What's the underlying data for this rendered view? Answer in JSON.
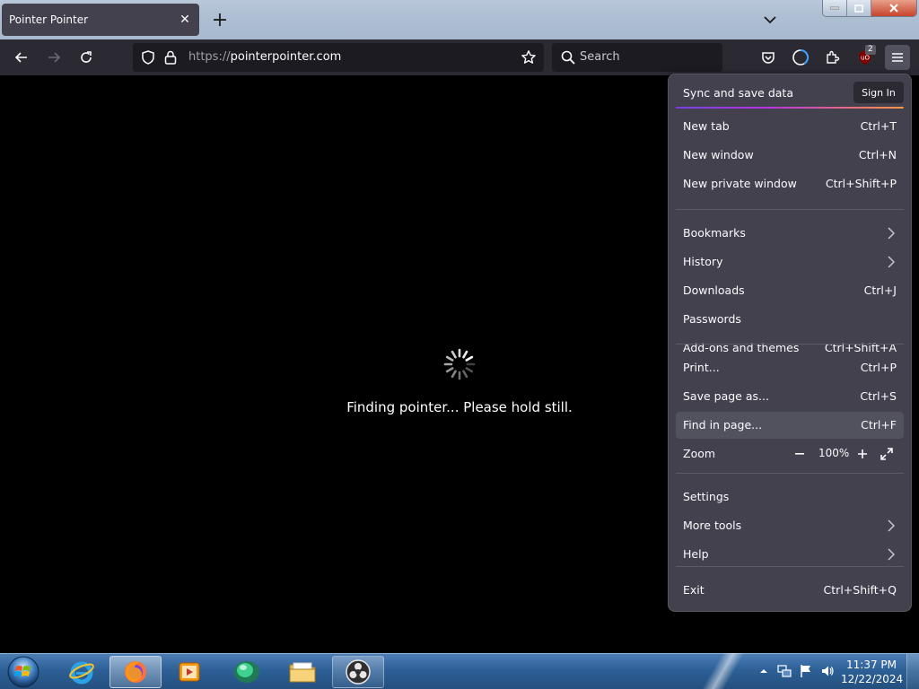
{
  "tab": {
    "title": "Pointer Pointer"
  },
  "url": {
    "scheme": "https://",
    "host": "pointerpointer.com"
  },
  "search": {
    "placeholder": "Search"
  },
  "extensions": {
    "ublock_count": "2"
  },
  "page": {
    "status": "Finding pointer... Please hold still."
  },
  "menu": {
    "sync_label": "Sync and save data",
    "signin_label": "Sign In",
    "groups": [
      [
        {
          "label": "New tab",
          "shortcut": "Ctrl+T"
        },
        {
          "label": "New window",
          "shortcut": "Ctrl+N"
        },
        {
          "label": "New private window",
          "shortcut": "Ctrl+Shift+P"
        }
      ],
      [
        {
          "label": "Bookmarks",
          "submenu": true
        },
        {
          "label": "History",
          "submenu": true
        },
        {
          "label": "Downloads",
          "shortcut": "Ctrl+J"
        },
        {
          "label": "Passwords"
        },
        {
          "label": "Add-ons and themes",
          "shortcut": "Ctrl+Shift+A"
        }
      ],
      [
        {
          "label": "Print...",
          "shortcut": "Ctrl+P"
        },
        {
          "label": "Save page as...",
          "shortcut": "Ctrl+S"
        },
        {
          "label": "Find in page...",
          "shortcut": "Ctrl+F",
          "highlighted": true
        },
        {
          "label": "Zoom",
          "zoom": true
        }
      ],
      [
        {
          "label": "Settings"
        },
        {
          "label": "More tools",
          "submenu": true
        },
        {
          "label": "Help",
          "submenu": true
        }
      ],
      [
        {
          "label": "Exit",
          "shortcut": "Ctrl+Shift+Q"
        }
      ]
    ],
    "zoom_value": "100%"
  },
  "taskbar": {
    "apps": [
      {
        "name": "internet-explorer",
        "state": ""
      },
      {
        "name": "firefox",
        "state": "active"
      },
      {
        "name": "media-player",
        "state": ""
      },
      {
        "name": "app-green",
        "state": ""
      },
      {
        "name": "file-explorer",
        "state": ""
      },
      {
        "name": "obs-studio",
        "state": "open"
      }
    ],
    "clock": {
      "time": "11:37 PM",
      "date": "12/22/2024"
    }
  },
  "colors": {
    "menu_bg": "#42414d",
    "toolbar_bg": "#2b2a33",
    "taskbar": "#2d6096"
  }
}
